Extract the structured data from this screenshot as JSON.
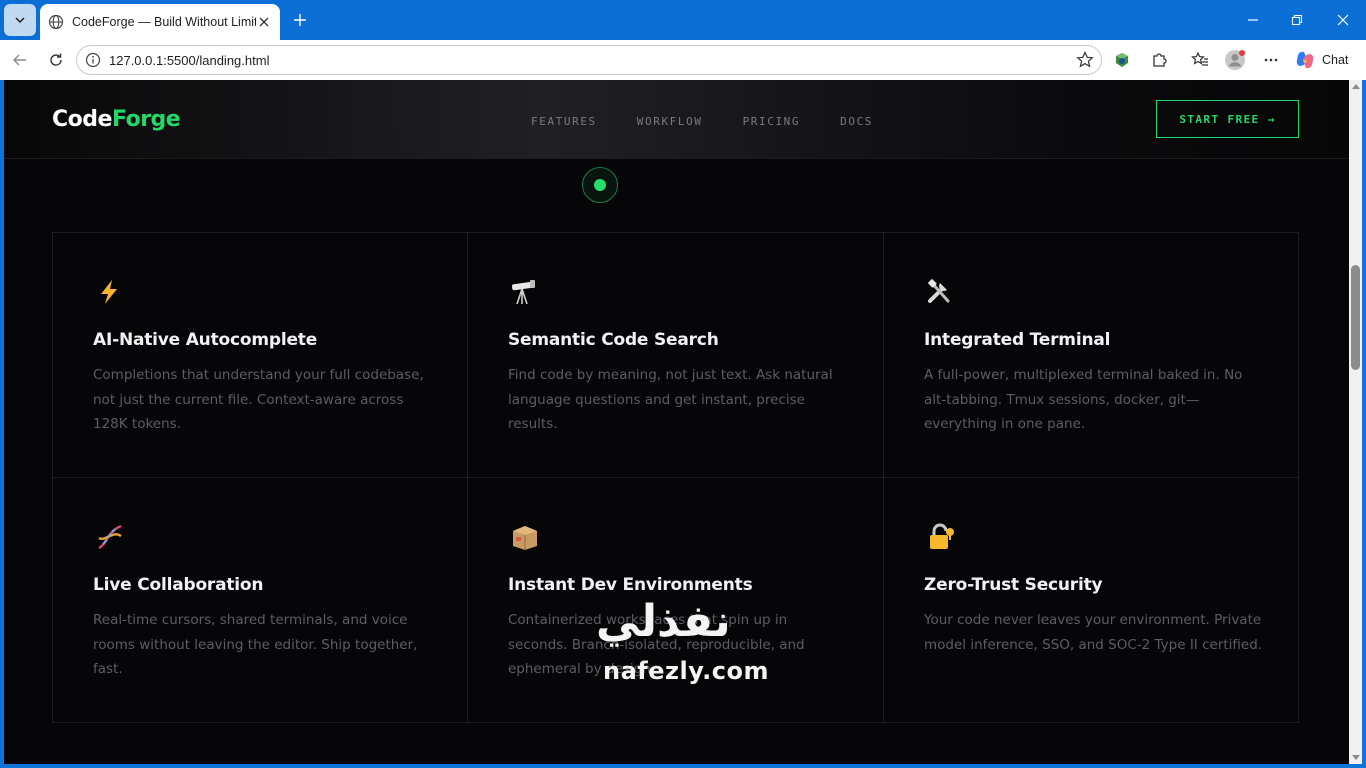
{
  "browser": {
    "tab_title": "CodeForge — Build Without Limits",
    "url": "127.0.0.1:5500/landing.html",
    "chat_label": "Chat"
  },
  "page": {
    "logo_part1": "Code",
    "logo_part2": "Forge",
    "nav": [
      "FEATURES",
      "WORKFLOW",
      "PRICING",
      "DOCS"
    ],
    "cta": "START FREE →",
    "accent_color": "#22d869",
    "features": [
      {
        "icon": "lightning-icon",
        "title": "AI-Native Autocomplete",
        "desc": "Completions that understand your full codebase, not just the current file. Context-aware across 128K tokens."
      },
      {
        "icon": "telescope-icon",
        "title": "Semantic Code Search",
        "desc": "Find code by meaning, not just text. Ask natural language questions and get instant, precise results."
      },
      {
        "icon": "tools-icon",
        "title": "Integrated Terminal",
        "desc": "A full-power, multiplexed terminal baked in. No alt-tabbing. Tmux sessions, docker, git—everything in one pane."
      },
      {
        "icon": "dna-icon",
        "title": "Live Collaboration",
        "desc": "Real-time cursors, shared terminals, and voice rooms without leaving the editor. Ship together, fast."
      },
      {
        "icon": "package-icon",
        "title": "Instant Dev Environments",
        "desc": "Containerized workspaces that spin up in seconds. Branch-isolated, reproducible, and ephemeral by design."
      },
      {
        "icon": "lock-icon",
        "title": "Zero-Trust Security",
        "desc": "Your code never leaves your environment. Private model inference, SSO, and SOC-2 Type II certified."
      }
    ]
  },
  "watermark": {
    "arabic": "نفذلي",
    "latin": "nafezly.com"
  }
}
